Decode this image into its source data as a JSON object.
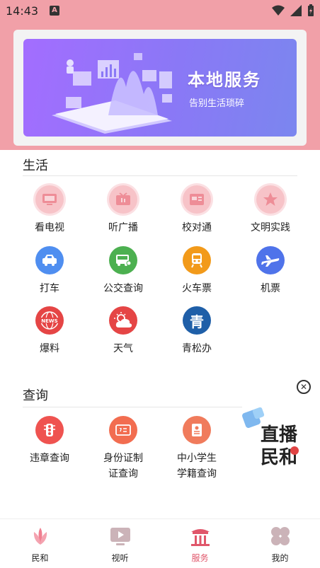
{
  "status_bar": {
    "time": "14:43",
    "sim_label": "A"
  },
  "banner": {
    "title": "本地服务",
    "subtitle": "告别生活琐碎"
  },
  "sections": {
    "life": {
      "title": "生活",
      "items": [
        {
          "label": "看电视",
          "icon": "tv-icon"
        },
        {
          "label": "听广播",
          "icon": "radio-icon"
        },
        {
          "label": "校对通",
          "icon": "proofread-icon"
        },
        {
          "label": "文明实践",
          "icon": "star-icon"
        },
        {
          "label": "打车",
          "icon": "taxi-icon"
        },
        {
          "label": "公交查询",
          "icon": "bus-icon"
        },
        {
          "label": "火车票",
          "icon": "train-icon"
        },
        {
          "label": "机票",
          "icon": "plane-icon"
        },
        {
          "label": "爆料",
          "icon": "news-icon"
        },
        {
          "label": "天气",
          "icon": "weather-icon"
        },
        {
          "label": "青松办",
          "icon": "qing-icon",
          "glyph": "青"
        }
      ]
    },
    "query": {
      "title": "查询",
      "items": [
        {
          "label": "违章查询",
          "icon": "traffic-light-icon"
        },
        {
          "label": "身份证制证查询",
          "icon": "id-card-icon"
        },
        {
          "label": "中小学生学籍查询",
          "icon": "student-record-icon"
        }
      ]
    }
  },
  "float_ad": {
    "text_line1": "直播",
    "text_line2": "民和"
  },
  "tabbar": {
    "tabs": [
      {
        "label": "民和",
        "icon": "lotus-icon",
        "active": false
      },
      {
        "label": "视听",
        "icon": "video-icon",
        "active": false
      },
      {
        "label": "服务",
        "icon": "building-icon",
        "active": true
      },
      {
        "label": "我的",
        "icon": "clover-icon",
        "active": false
      }
    ]
  },
  "colors": {
    "header": "#f1a0a8",
    "accent": "#e0566a",
    "banner_from": "#a36dff",
    "banner_to": "#7b86ef"
  }
}
